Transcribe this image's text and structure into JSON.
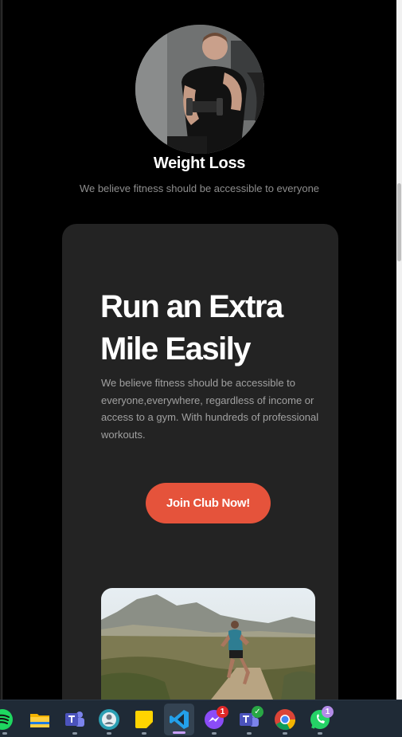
{
  "profile": {
    "title": "Weight Loss",
    "subtitle": "We believe fitness should be accessible to everyone"
  },
  "card": {
    "headline_line1": "Run an Extra",
    "headline_line2": "Mile Easily",
    "description": "We believe fitness should be accessible to everyone,everywhere, regardless of income or access to a gym. With hundreds of professional workouts.",
    "cta_label": "Join Club Now!"
  },
  "colors": {
    "background": "#000000",
    "card": "#232323",
    "accent": "#e5533b",
    "muted_text": "#8e8e8e",
    "taskbar": "#1f2a36"
  },
  "taskbar": {
    "apps": [
      "spotify-icon",
      "file-explorer-icon",
      "teams-icon",
      "edge-profile-icon",
      "sticky-notes-icon",
      "vscode-icon",
      "messenger-icon",
      "teams-work-icon",
      "chrome-icon",
      "whatsapp-icon"
    ],
    "messenger_badge": "1",
    "whatsapp_badge": "1"
  }
}
